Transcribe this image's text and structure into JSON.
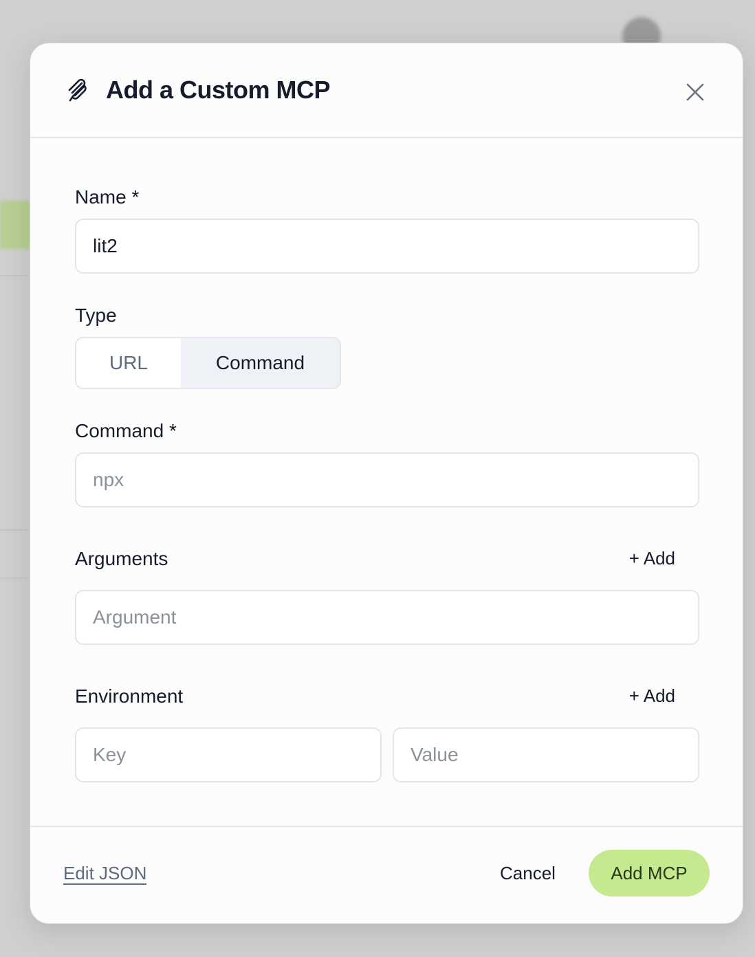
{
  "dialog": {
    "title": "Add a Custom MCP",
    "icon": "paperclip-icon",
    "close_icon": "close-icon"
  },
  "form": {
    "name": {
      "label": "Name *",
      "value": "lit2"
    },
    "type": {
      "label": "Type",
      "options": [
        "URL",
        "Command"
      ],
      "selected": "Command"
    },
    "command": {
      "label": "Command *",
      "value": "",
      "placeholder": "npx"
    },
    "arguments": {
      "label": "Arguments",
      "add_label": "+ Add",
      "placeholder": "Argument",
      "value": ""
    },
    "environment": {
      "label": "Environment",
      "add_label": "+ Add",
      "key_placeholder": "Key",
      "value_placeholder": "Value"
    }
  },
  "footer": {
    "edit_json_label": "Edit JSON",
    "cancel_label": "Cancel",
    "submit_label": "Add MCP"
  },
  "colors": {
    "accent": "#c6e98f",
    "text_primary": "#161c2b",
    "text_muted": "#5d6b80",
    "selected_segment": "#eef2f6"
  }
}
